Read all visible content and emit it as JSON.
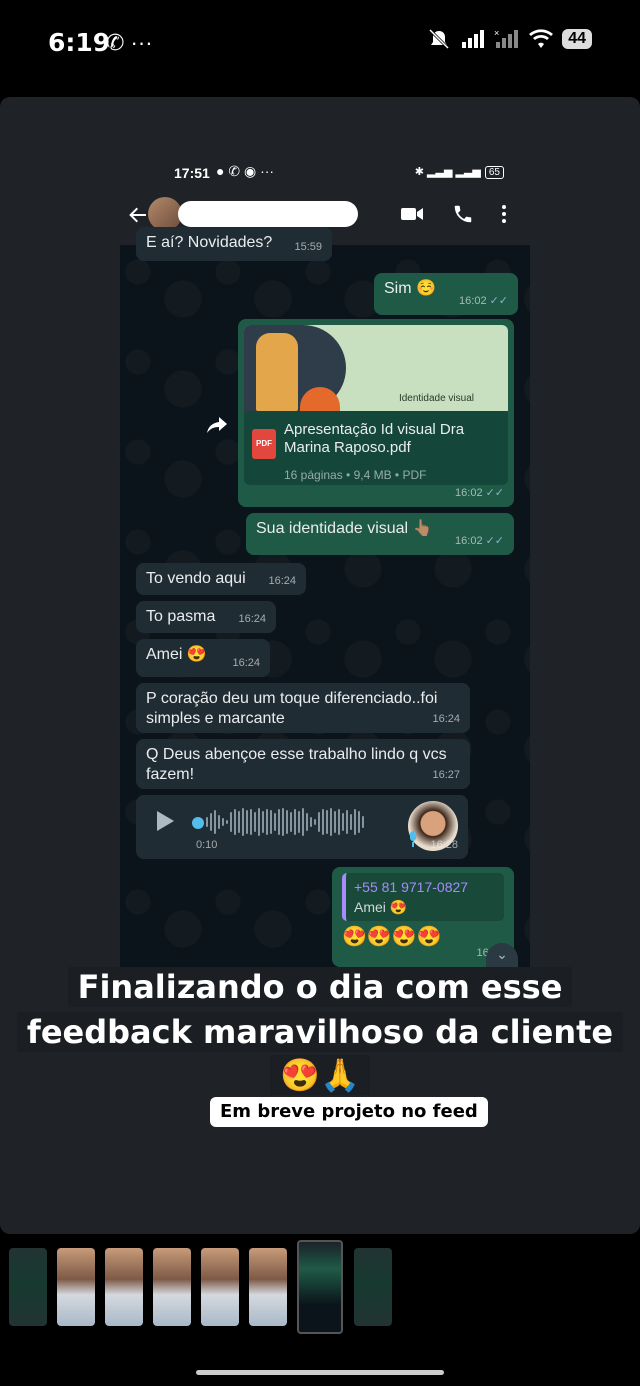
{
  "device_status": {
    "time": "6:19",
    "left_icons": "✆ ···",
    "battery": "44"
  },
  "inner_status": {
    "time": "17:51",
    "icons": "● ✆ ◉ ···",
    "battery": "65"
  },
  "messages": {
    "m0": {
      "text": "E aí? Novidades?",
      "time": "15:59"
    },
    "m1": {
      "text": "Sim ☺️",
      "time": "16:02"
    },
    "doc": {
      "preview_label": "Identidade visual",
      "badge": "PDF",
      "title": "Apresentação Id visual Dra Marina Raposo.pdf",
      "meta": "16 páginas • 9,4 MB • PDF",
      "time": "16:02"
    },
    "m2": {
      "text": "Sua identidade visual 👆🏽",
      "time": "16:02"
    },
    "m3": {
      "text": "To vendo aqui",
      "time": "16:24"
    },
    "m4": {
      "text": "To pasma",
      "time": "16:24"
    },
    "m5": {
      "text": "Amei 😍",
      "time": "16:24"
    },
    "m6": {
      "text": "P coração deu um toque diferenciado..foi simples e marcante",
      "time": "16:24"
    },
    "m7": {
      "text": "Q Deus abençoe esse trabalho lindo q vcs fazem!",
      "time": "16:27"
    },
    "voice": {
      "duration": "0:10",
      "time": "16:28"
    },
    "reply": {
      "quote_author": "+55 81 9717-0827",
      "quote_text": "Amei 😍",
      "text": "😍😍😍😍",
      "time": "16:30"
    }
  },
  "caption": {
    "line1": "Finalizando o dia com esse",
    "line2": "feedback maravilhoso da cliente",
    "line3": "😍🙏",
    "pill": "Em breve projeto no feed"
  }
}
